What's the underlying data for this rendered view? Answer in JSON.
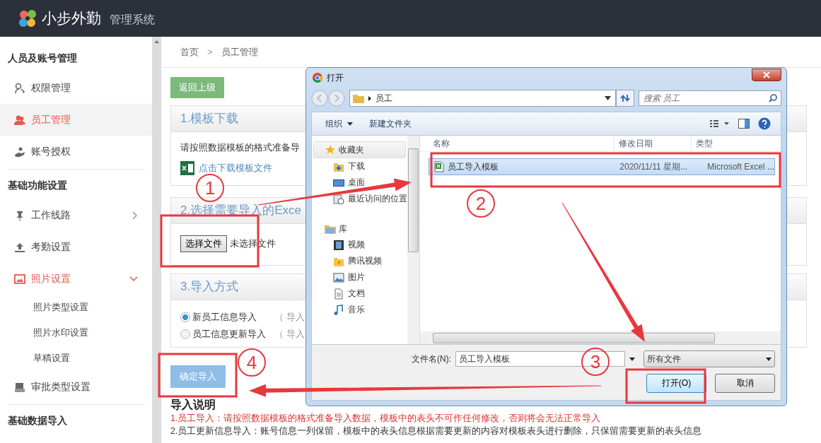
{
  "header": {
    "logo_text": "小步外勤",
    "subtitle": "管理系统"
  },
  "sidebar": {
    "sections": [
      {
        "title": "人员及账号管理",
        "items": [
          {
            "label": "权限管理",
            "selected": false
          },
          {
            "label": "员工管理",
            "selected": true
          },
          {
            "label": "账号授权",
            "selected": false
          }
        ]
      },
      {
        "title": "基础功能设置",
        "items": [
          {
            "label": "工作线路",
            "selected": false,
            "expanded": false
          },
          {
            "label": "考勤设置",
            "selected": false
          },
          {
            "label": "照片设置",
            "selected": false,
            "expanded": true,
            "children": [
              {
                "label": "照片类型设置"
              },
              {
                "label": "照片水印设置"
              },
              {
                "label": "草稿设置"
              }
            ]
          },
          {
            "label": "审批类型设置",
            "selected": false
          }
        ]
      },
      {
        "title": "基础数据导入"
      }
    ]
  },
  "breadcrumb": {
    "items": [
      "首页",
      "员工管理"
    ],
    "separator": ">"
  },
  "back_button": "返回上级",
  "panels": [
    {
      "kind": "download",
      "title": "1.模板下载",
      "text": "请按照数据模板的格式准备导",
      "link": "点击下载模板文件"
    },
    {
      "kind": "file",
      "title": "2.选择需要导入的Exce",
      "button": "选择文件",
      "status": "未选择文件"
    },
    {
      "kind": "options",
      "title": "3.导入方式",
      "options": [
        {
          "label": "新员工信息导入",
          "note": "（ 导入",
          "selected": true
        },
        {
          "label": "员工信息更新导入",
          "note": "（ 导入",
          "selected": false
        }
      ]
    }
  ],
  "confirm_button": {
    "label": "确定导入",
    "disabled": true
  },
  "instructions": {
    "title": "导入说明",
    "lines": [
      {
        "kind": "warning",
        "text": "1.员工导入：请按照数据模板的格式准备导入数据，模板中的表头不可作任何修改，否则将会无法正常导入"
      },
      {
        "kind": "normal",
        "text": "2.员工更新信息导入：账号信息一列保留，模板中的表头信息根据需要更新的内容对模板表头进行删除，只保留需要更新的表头信息"
      }
    ]
  },
  "dialog": {
    "title": "打开",
    "path": [
      "员工"
    ],
    "search": {
      "placeholder": "搜索 员工"
    },
    "toolbar": [
      {
        "label": "组织",
        "dropdown": true
      },
      {
        "label": "新建文件夹",
        "dropdown": false
      }
    ],
    "nav": [
      {
        "label": "收藏夹",
        "children": [
          {
            "label": "下载"
          },
          {
            "label": "桌面"
          },
          {
            "label": "最近访问的位置"
          }
        ]
      },
      {
        "label": "库",
        "children": [
          {
            "label": "视频"
          },
          {
            "label": "腾讯视频"
          },
          {
            "label": "图片"
          },
          {
            "label": "文档"
          },
          {
            "label": "音乐"
          }
        ]
      }
    ],
    "columns": [
      "名称",
      "修改日期",
      "类型"
    ],
    "files": [
      {
        "name": "员工导入模板",
        "date": "2020/11/11 星期...",
        "type": "Microsoft Excel ...",
        "selected": true
      }
    ],
    "filename_label": "文件名(N):",
    "filename": "员工导入模板",
    "filter": "所有文件",
    "buttons": [
      "打开(O)",
      "取消"
    ]
  },
  "annotations": [
    {
      "number": "1"
    },
    {
      "number": "2"
    },
    {
      "number": "3"
    },
    {
      "number": "4"
    }
  ]
}
